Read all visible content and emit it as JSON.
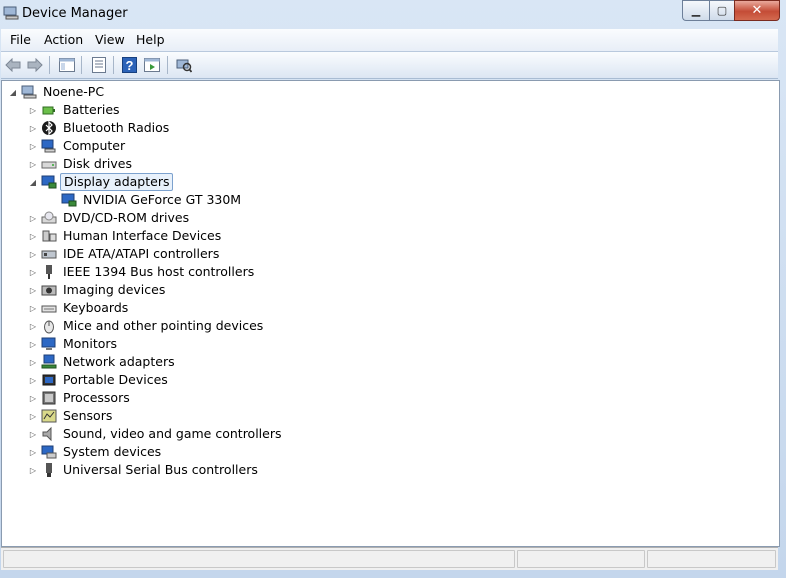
{
  "window": {
    "title": "Device Manager"
  },
  "menu": [
    "File",
    "Action",
    "View",
    "Help"
  ],
  "toolbar": [
    "back",
    "forward",
    "show-hide-console-tree",
    "properties",
    "help",
    "action-pane",
    "scan-for-hardware-changes"
  ],
  "tree": {
    "root": "Noene-PC",
    "categories": [
      {
        "label": "Batteries",
        "icon": "battery-icon"
      },
      {
        "label": "Bluetooth Radios",
        "icon": "bluetooth-icon"
      },
      {
        "label": "Computer",
        "icon": "computer-icon"
      },
      {
        "label": "Disk drives",
        "icon": "disk-drive-icon"
      },
      {
        "label": "Display adapters",
        "icon": "display-adapter-icon",
        "expanded": true,
        "selected": true,
        "children": [
          "NVIDIA GeForce GT 330M"
        ]
      },
      {
        "label": "DVD/CD-ROM drives",
        "icon": "dvd-drive-icon"
      },
      {
        "label": "Human Interface Devices",
        "icon": "hid-icon"
      },
      {
        "label": "IDE ATA/ATAPI controllers",
        "icon": "ide-controller-icon"
      },
      {
        "label": "IEEE 1394 Bus host controllers",
        "icon": "ieee1394-icon"
      },
      {
        "label": "Imaging devices",
        "icon": "camera-icon"
      },
      {
        "label": "Keyboards",
        "icon": "keyboard-icon"
      },
      {
        "label": "Mice and other pointing devices",
        "icon": "mouse-icon"
      },
      {
        "label": "Monitors",
        "icon": "monitor-icon"
      },
      {
        "label": "Network adapters",
        "icon": "network-adapter-icon"
      },
      {
        "label": "Portable Devices",
        "icon": "portable-device-icon"
      },
      {
        "label": "Processors",
        "icon": "processor-icon"
      },
      {
        "label": "Sensors",
        "icon": "sensor-icon"
      },
      {
        "label": "Sound, video and game controllers",
        "icon": "speaker-icon"
      },
      {
        "label": "System devices",
        "icon": "system-device-icon"
      },
      {
        "label": "Universal Serial Bus controllers",
        "icon": "usb-icon"
      }
    ]
  }
}
